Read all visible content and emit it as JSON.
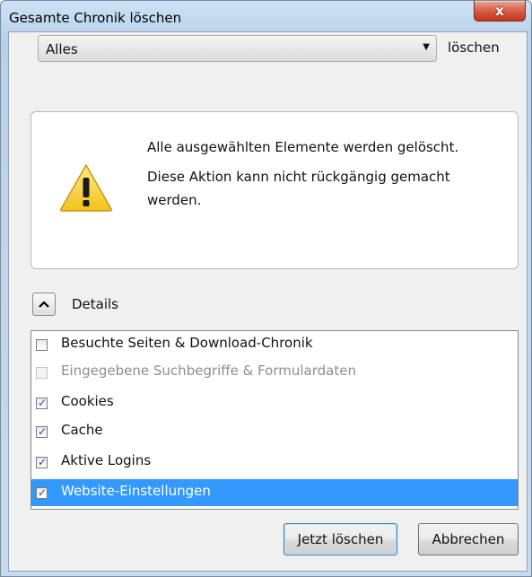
{
  "window": {
    "title": "Gesamte Chronik löschen",
    "close_glyph": "x"
  },
  "time_range": {
    "selected": "Alles",
    "suffix": "löschen"
  },
  "warning": {
    "line1": "Alle ausgewählten Elemente werden gelöscht.",
    "line2": "Diese Aktion kann nicht rückgängig gemacht werden."
  },
  "details": {
    "toggle_glyph": "^",
    "label": "Details",
    "expanded": true
  },
  "items": [
    {
      "label": "Besuchte Seiten & Download-Chronik",
      "checked": false,
      "enabled": true,
      "selected": false
    },
    {
      "label": "Eingegebene Suchbegriffe & Formulardaten",
      "checked": false,
      "enabled": false,
      "selected": false
    },
    {
      "label": "Cookies",
      "checked": true,
      "enabled": true,
      "selected": false
    },
    {
      "label": "Cache",
      "checked": true,
      "enabled": true,
      "selected": false
    },
    {
      "label": "Aktive Logins",
      "checked": true,
      "enabled": true,
      "selected": false
    },
    {
      "label": "Website-Einstellungen",
      "checked": true,
      "enabled": true,
      "selected": true
    }
  ],
  "buttons": {
    "ok": "Jetzt löschen",
    "cancel": "Abbrechen"
  },
  "colors": {
    "selection": "#3399ff",
    "close_button": "#d5593f",
    "warning_yellow": "#f6d23a"
  }
}
